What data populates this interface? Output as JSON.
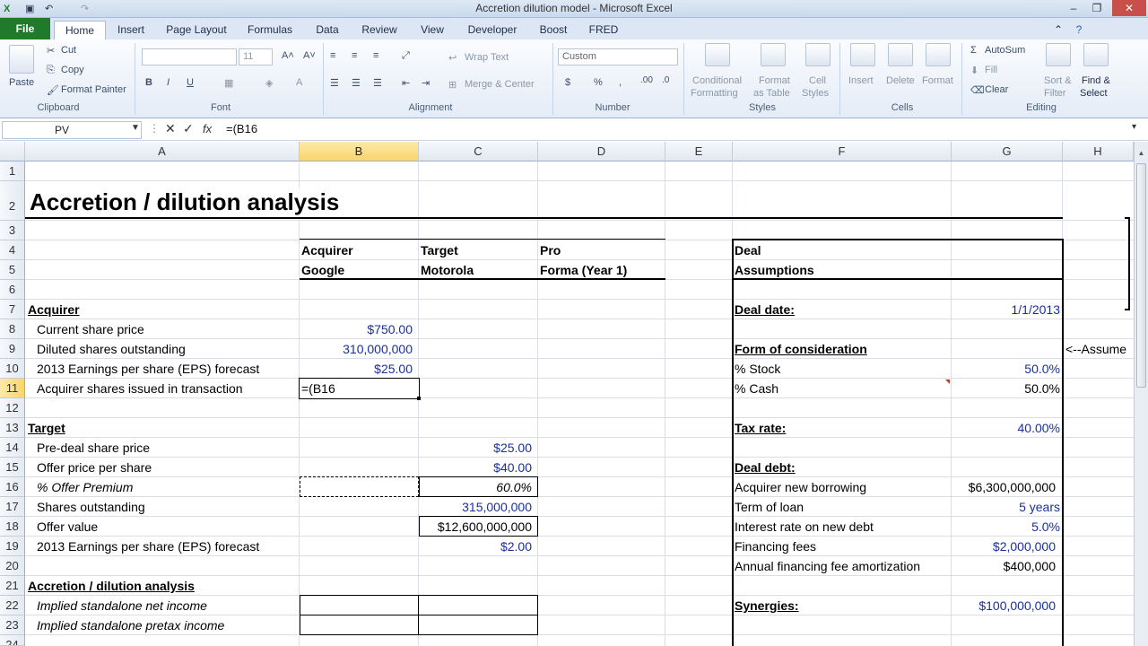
{
  "window": {
    "title": "Accretion dilution model  -  Microsoft Excel"
  },
  "tabs": [
    "File",
    "Home",
    "Insert",
    "Page Layout",
    "Formulas",
    "Data",
    "Review",
    "View",
    "Developer",
    "Boost",
    "FRED"
  ],
  "ribbon": {
    "clipboard": {
      "paste": "Paste",
      "cut": "Cut",
      "copy": "Copy",
      "format_painter": "Format Painter",
      "label": "Clipboard"
    },
    "font": {
      "size": "11",
      "label": "Font",
      "bold": "B",
      "italic": "I",
      "underline": "U"
    },
    "alignment": {
      "wrap": "Wrap Text",
      "merge": "Merge & Center",
      "label": "Alignment"
    },
    "number": {
      "format": "Custom",
      "currency": "$",
      "percent": "%",
      "label": "Number"
    },
    "styles": {
      "conditional": "Conditional",
      "conditional2": "Formatting",
      "format_table": "Format",
      "format_table2": "as Table",
      "cell_styles": "Cell",
      "cell_styles2": "Styles",
      "label": "Styles"
    },
    "cells": {
      "insert": "Insert",
      "delete": "Delete",
      "format": "Format",
      "label": "Cells"
    },
    "editing": {
      "autosum": "AutoSum",
      "fill": "Fill",
      "clear": "Clear",
      "sort": "Sort &",
      "sort2": "Filter",
      "find": "Find &",
      "find2": "Select",
      "label": "Editing"
    }
  },
  "formula_bar": {
    "name_box": "PV",
    "fx": "fx",
    "formula": "=(B16"
  },
  "columns": [
    "A",
    "B",
    "C",
    "D",
    "E",
    "F",
    "G",
    "H"
  ],
  "rows": [
    "1",
    "2",
    "3",
    "4",
    "5",
    "6",
    "7",
    "8",
    "9",
    "10",
    "11",
    "12",
    "13",
    "14",
    "15",
    "16",
    "17",
    "18",
    "19",
    "20",
    "21",
    "22",
    "23",
    "24"
  ],
  "cells": {
    "title": "Accretion / dilution analysis",
    "b4": "Acquirer",
    "b5": "Google",
    "c4": "Target",
    "c5": "Motorola",
    "d4": "Pro",
    "d5": "Forma (Year 1)",
    "f4": "Deal",
    "f5": "Assumptions",
    "a7": "Acquirer",
    "a8": "Current share price",
    "b8": "$750.00",
    "a9": "Diluted shares outstanding",
    "b9": "310,000,000",
    "a10": "2013 Earnings per share (EPS) forecast",
    "b10": "$25.00",
    "a11": "Acquirer shares issued in transaction",
    "b11": "=(B16",
    "a13": "Target",
    "a14": "Pre-deal share price",
    "c14": "$25.00",
    "a15": "Offer price per share",
    "c15": "$40.00",
    "a16": "% Offer Premium",
    "c16": "60.0%",
    "a17": "Shares outstanding",
    "c17": "315,000,000",
    "a18": "Offer value",
    "c18": "$12,600,000,000",
    "a19": "2013 Earnings per share (EPS) forecast",
    "c19": "$2.00",
    "a21": "Accretion / dilution analysis",
    "a22": "Implied standalone net income",
    "a23": "Implied standalone pretax income",
    "f7": "Deal date:",
    "g7": "1/1/2013",
    "f9": "Form of consideration",
    "h9": "<--Assume",
    "f10": "% Stock",
    "g10": "50.0%",
    "f11": "% Cash",
    "g11": "50.0%",
    "f13": "Tax rate:",
    "g13": "40.00%",
    "f15": "Deal debt:",
    "f16": "Acquirer new borrowing",
    "g16": "$6,300,000,000",
    "f17": "Term of loan",
    "g17": "5 years",
    "f18": "Interest rate on new debt",
    "g18": "5.0%",
    "f19": "Financing fees",
    "g19": "$2,000,000",
    "f20": "Annual financing fee amortization",
    "g20": "$400,000",
    "f22": "Synergies:",
    "g22": "$100,000,000"
  },
  "colors": {
    "accent": "#1f7a2b",
    "input_blue": "#1a2f9e",
    "selected_header": "#f9d66b"
  }
}
